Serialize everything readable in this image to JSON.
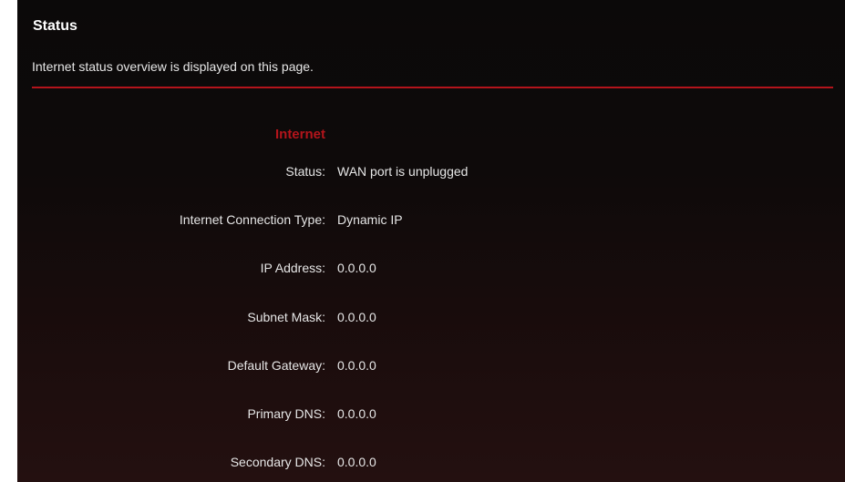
{
  "header": {
    "title": "Status",
    "description": "Internet status overview is displayed on this page."
  },
  "internet": {
    "heading": "Internet",
    "fields": [
      {
        "label": "Status:",
        "value": "WAN port is unplugged"
      },
      {
        "label": "Internet Connection Type:",
        "value": "Dynamic IP"
      },
      {
        "label": "IP Address:",
        "value": "0.0.0.0"
      },
      {
        "label": "Subnet Mask:",
        "value": "0.0.0.0"
      },
      {
        "label": "Default Gateway:",
        "value": "0.0.0.0"
      },
      {
        "label": "Primary DNS:",
        "value": "0.0.0.0"
      },
      {
        "label": "Secondary DNS:",
        "value": "0.0.0.0"
      }
    ]
  },
  "colors": {
    "accent": "#b3141b",
    "background": "#0e0a0a",
    "text": "#e6e6e6"
  }
}
